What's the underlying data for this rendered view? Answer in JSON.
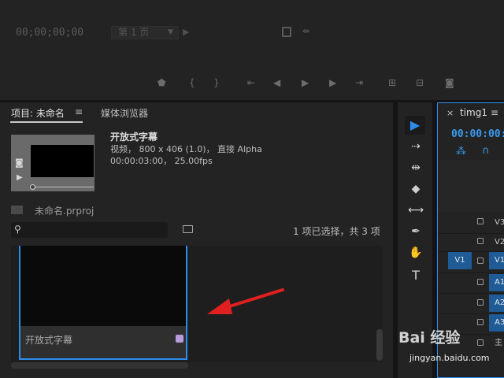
{
  "monitor": {
    "timecode": "00;00;00;00",
    "page_select": "第 1 页"
  },
  "project": {
    "tab_label": "项目: 未命名",
    "tab_menu": "≡",
    "media_tab": "媒体浏览器",
    "clip_name": "开放式字幕",
    "clip_info": "视频， 800 x 406 (1.0)， 直接 Alpha",
    "clip_duration": "00:00:03:00， 25.00fps",
    "project_file": "未命名.prproj",
    "search_placeholder": "",
    "selection_status": "1 项已选择，共 3 项",
    "tile_label": "开放式字幕",
    "badge_color": "#b79bdc"
  },
  "timeline": {
    "close": "×",
    "tab": "timg1",
    "menu": "≡",
    "timecode": "00:00:00:",
    "tracks": [
      {
        "name": "V3",
        "active": false
      },
      {
        "name": "V2",
        "active": false
      },
      {
        "name": "V1",
        "active": true
      },
      {
        "name": "A1",
        "active": true
      },
      {
        "name": "A2",
        "active": true
      },
      {
        "name": "A3",
        "active": true
      },
      {
        "name": "主",
        "active": false
      }
    ],
    "source_patch": "V1"
  },
  "watermark": {
    "brand": "Bai 经验",
    "url": "jingyan.baidu.com"
  },
  "colors": {
    "accent": "#2d8ceb",
    "arrow": "#e02020"
  }
}
